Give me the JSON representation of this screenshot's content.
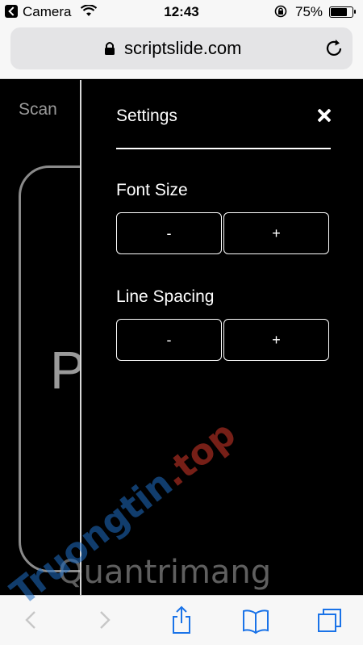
{
  "status_bar": {
    "carrier": "Camera",
    "time": "12:43",
    "battery": "75%"
  },
  "browser": {
    "url": "scriptslide.com"
  },
  "page": {
    "scan_label": "Scan",
    "card_letter": "P"
  },
  "settings": {
    "title": "Settings",
    "font_size_label": "Font Size",
    "line_spacing_label": "Line Spacing",
    "minus_label": "-",
    "plus_label": "+"
  },
  "toolbar": {
    "icons": [
      "back-icon",
      "forward-icon",
      "share-icon",
      "bookmarks-icon",
      "tabs-icon"
    ]
  },
  "watermark": {
    "site1_prefix": "Truongtin",
    "site1_suffix": ".top",
    "site2": "Quantrimang"
  },
  "colors": {
    "panel_bg": "#000000",
    "accent": "#ffffff",
    "toolbar_icon": "#1a73e8"
  }
}
